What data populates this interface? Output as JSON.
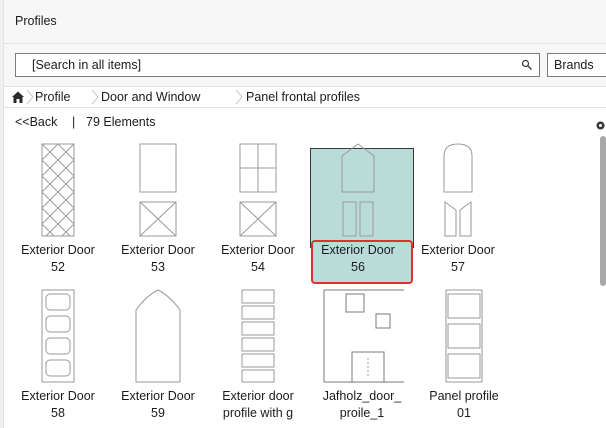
{
  "title": "Profiles",
  "search": {
    "placeholder": "[Search in all items]",
    "brands_label": "Brands"
  },
  "breadcrumb": [
    "Profile",
    "Door and Window",
    "Panel frontal profiles"
  ],
  "status": {
    "back_label": "<<Back",
    "separator": "|",
    "count_label": "79 Elements"
  },
  "items": [
    {
      "line1": "Exterior Door",
      "line2": "52",
      "icon": "diamond-lattice-door-icon"
    },
    {
      "line1": "Exterior Door",
      "line2": "53",
      "icon": "rect-x-panel-door-icon"
    },
    {
      "line1": "Exterior Door",
      "line2": "54",
      "icon": "four-pane-x-door-icon"
    },
    {
      "line1": "Exterior Door",
      "line2": "56",
      "icon": "pointed-arch-door-icon"
    },
    {
      "line1": "Exterior Door",
      "line2": "57",
      "icon": "round-arch-door-icon"
    },
    {
      "line1": "Exterior Door",
      "line2": "58",
      "icon": "four-rounded-panels-icon"
    },
    {
      "line1": "Exterior Door",
      "line2": "59",
      "icon": "curved-top-door-icon"
    },
    {
      "line1": "Exterior door",
      "line2": "profile with g",
      "icon": "stacked-bars-door-icon"
    },
    {
      "line1": "Jafholz_door_",
      "line2": "proile_1",
      "icon": "jafholz-door-icon",
      "selected": true
    },
    {
      "line1": "Panel profile",
      "line2": "01",
      "icon": "three-panel-door-icon"
    }
  ],
  "colors": {
    "selected_bg": "#b9dcd9",
    "selected_outline": "#e03131",
    "scroll_thumb": "#a8a8a8"
  }
}
